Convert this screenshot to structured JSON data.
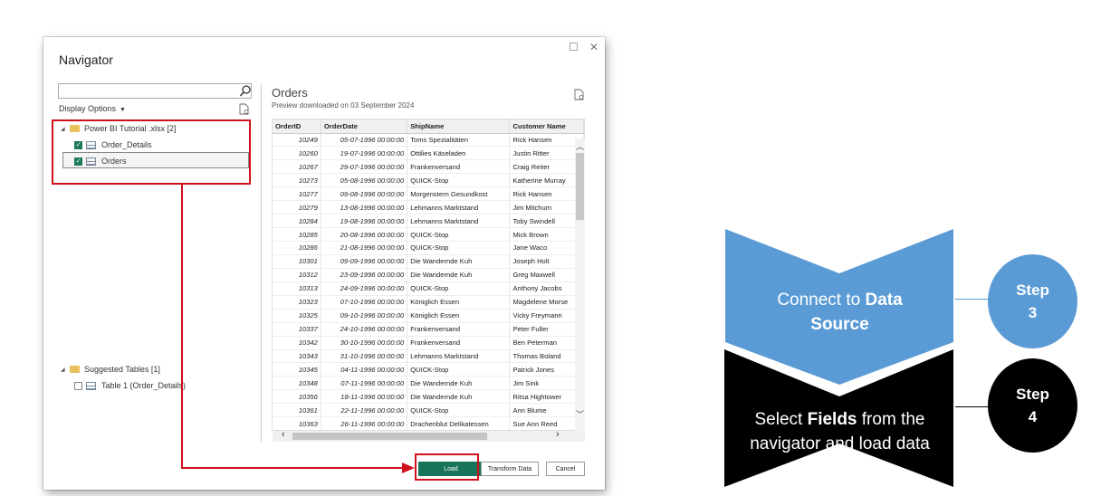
{
  "navigator": {
    "title": "Navigator",
    "window_controls": {
      "maximize": "☐",
      "close": "✕"
    },
    "search": {
      "value": "",
      "placeholder": ""
    },
    "display_options": "Display Options",
    "tree": {
      "root": "Power BI Tutorial .xlsx [2]",
      "items": [
        {
          "label": "Order_Details",
          "checked": true
        },
        {
          "label": "Orders",
          "checked": true
        }
      ],
      "suggested_root": "Suggested Tables [1]",
      "suggested_items": [
        {
          "label": "Table 1 (Order_Details)",
          "checked": false
        }
      ]
    },
    "preview": {
      "title": "Orders",
      "subtitle": "Preview downloaded on 03 September 2024",
      "columns": [
        "OrderID",
        "OrderDate",
        "ShipName",
        "Customer Name"
      ],
      "rows": [
        [
          "10249",
          "05-07-1996 00:00:00",
          "Toms Spezialitäten",
          "Rick Hansen"
        ],
        [
          "10260",
          "19-07-1996 00:00:00",
          "Ottilies Käseladen",
          "Justin Ritter"
        ],
        [
          "10267",
          "29-07-1996 00:00:00",
          "Frankenversand",
          "Craig Reiter"
        ],
        [
          "10273",
          "05-08-1996 00:00:00",
          "QUICK-Stop",
          "Katherine Murray"
        ],
        [
          "10277",
          "09-08-1996 00:00:00",
          "Morgenstern Gesundkost",
          "Rick Hansen"
        ],
        [
          "10279",
          "13-08-1996 00:00:00",
          "Lehmanns Marktstand",
          "Jim Mitchum"
        ],
        [
          "10284",
          "19-08-1996 00:00:00",
          "Lehmanns Marktstand",
          "Toby Swindell"
        ],
        [
          "10285",
          "20-08-1996 00:00:00",
          "QUICK-Stop",
          "Mick Brown"
        ],
        [
          "10286",
          "21-08-1996 00:00:00",
          "QUICK-Stop",
          "Jane Waco"
        ],
        [
          "10301",
          "09-09-1996 00:00:00",
          "Die Wandernde Kuh",
          "Joseph Holt"
        ],
        [
          "10312",
          "23-09-1996 00:00:00",
          "Die Wandernde Kuh",
          "Greg Maxwell"
        ],
        [
          "10313",
          "24-09-1996 00:00:00",
          "QUICK-Stop",
          "Anthony Jacobs"
        ],
        [
          "10323",
          "07-10-1996 00:00:00",
          "Königlich Essen",
          "Magdelene Morse"
        ],
        [
          "10325",
          "09-10-1996 00:00:00",
          "Königlich Essen",
          "Vicky Freymann"
        ],
        [
          "10337",
          "24-10-1996 00:00:00",
          "Frankenversand",
          "Peter Fuller"
        ],
        [
          "10342",
          "30-10-1996 00:00:00",
          "Frankenversand",
          "Ben Peterman"
        ],
        [
          "10343",
          "31-10-1996 00:00:00",
          "Lehmanns Marktstand",
          "Thomas Boland"
        ],
        [
          "10345",
          "04-11-1996 00:00:00",
          "QUICK-Stop",
          "Patrick Jones"
        ],
        [
          "10348",
          "07-11-1996 00:00:00",
          "Die Wandernde Kuh",
          "Jim Sink"
        ],
        [
          "10356",
          "18-11-1996 00:00:00",
          "Die Wandernde Kuh",
          "Ritsa Hightower"
        ],
        [
          "10361",
          "22-11-1996 00:00:00",
          "QUICK-Stop",
          "Ann Blume"
        ],
        [
          "10363",
          "26-11-1996 00:00:00",
          "Drachenblut Delikatessen",
          "Sue Ann Reed"
        ]
      ]
    },
    "buttons": {
      "load": "Load",
      "transform": "Transform Data",
      "cancel": "Cancel"
    }
  },
  "steps": {
    "step3": {
      "label": "Step",
      "number": "3",
      "text_pre": "Connect to ",
      "text_bold1": "Data",
      "text_bold2": "Source"
    },
    "step4": {
      "label": "Step",
      "number": "4",
      "text_pre": "Select ",
      "text_bold": "Fields",
      "text_post": " from the",
      "text_line2": "navigator and load data"
    }
  },
  "colors": {
    "accent_green": "#17745a",
    "annotation_red": "#d0101c",
    "step_blue": "#5b9bd5",
    "step_black": "#000000"
  }
}
